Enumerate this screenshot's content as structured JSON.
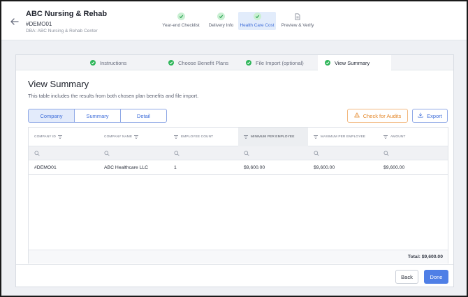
{
  "header": {
    "title": "ABC Nursing & Rehab",
    "id": "#DEMO01",
    "dba": "DBA: ABC Nursing & Rehab Center"
  },
  "stepper": [
    {
      "label": "Year-end Checklist",
      "state": "complete",
      "icon": "check-icon"
    },
    {
      "label": "Delivery Info",
      "state": "complete",
      "icon": "check-icon"
    },
    {
      "label": "Health Care Cost",
      "state": "active",
      "icon": "check-icon"
    },
    {
      "label": "Preview & Verify",
      "state": "pending",
      "icon": "document-icon"
    }
  ],
  "subtabs": [
    {
      "label": "Instructions"
    },
    {
      "label": "Choose Benefit Plans"
    },
    {
      "label": "File Import (optional)"
    },
    {
      "label": "View Summary"
    }
  ],
  "main": {
    "title": "View Summary",
    "description": "This table includes the results from both chosen plan benefits and file import."
  },
  "view_toggle": [
    "Company",
    "Summary",
    "Detail"
  ],
  "actions": {
    "audit": "Check for Audits",
    "export": "Export"
  },
  "table": {
    "columns": [
      "Company ID",
      "Company Name",
      "Employee Count",
      "Minimum per Employee",
      "Maximum per Employee",
      "Amount"
    ],
    "rows": [
      [
        "#DEMO01",
        "ABC Healthcare LLC",
        "1",
        "$9,600.00",
        "$9,600.00",
        "$9,600.00"
      ]
    ],
    "total": "Total: $9,600.00"
  },
  "footer": {
    "back": "Back",
    "done": "Done"
  },
  "colors": {
    "accent": "#4f7fe6",
    "success": "#2fb65a",
    "warning": "#e48628"
  }
}
